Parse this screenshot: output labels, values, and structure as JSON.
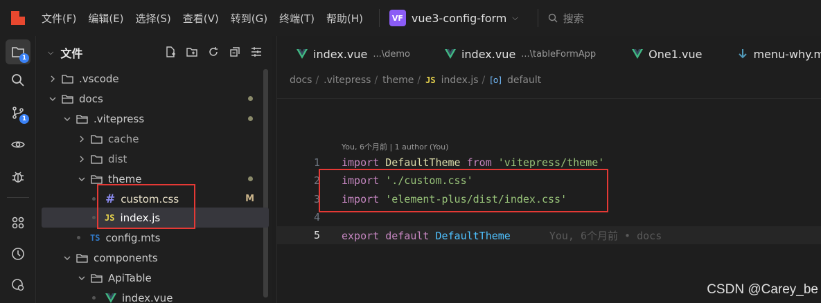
{
  "menu": [
    "文件(F)",
    "编辑(E)",
    "选择(S)",
    "查看(V)",
    "转到(G)",
    "终端(T)",
    "帮助(H)"
  ],
  "project": {
    "badge": "VF",
    "name": "vue3-config-form"
  },
  "search": {
    "placeholder": "搜索"
  },
  "activity_badges": {
    "explorer": "1",
    "scm": "1"
  },
  "sidebar": {
    "title": "文件",
    "tree": [
      {
        "label": ".vscode",
        "type": "folder",
        "expanded": false
      },
      {
        "label": "docs",
        "type": "folder",
        "expanded": true
      },
      {
        "label": ".vitepress",
        "type": "folder",
        "expanded": true
      },
      {
        "label": "cache",
        "type": "folder",
        "expanded": false
      },
      {
        "label": "dist",
        "type": "folder",
        "expanded": false
      },
      {
        "label": "theme",
        "type": "folder",
        "expanded": true
      },
      {
        "label": "custom.css",
        "type": "css",
        "status": "M"
      },
      {
        "label": "index.js",
        "type": "js",
        "selected": true
      },
      {
        "label": "config.mts",
        "type": "ts"
      },
      {
        "label": "components",
        "type": "folder",
        "expanded": true
      },
      {
        "label": "ApiTable",
        "type": "folder",
        "expanded": true
      },
      {
        "label": "index.vue",
        "type": "vue"
      }
    ]
  },
  "tabs": [
    {
      "name": "index.vue",
      "sub": "...\\demo",
      "icon": "vue-icon"
    },
    {
      "name": "index.vue",
      "sub": "...\\tableFormApp",
      "icon": "vue-icon"
    },
    {
      "name": "One1.vue",
      "sub": "",
      "icon": "vue-icon"
    },
    {
      "name": "menu-why.md",
      "sub": "",
      "icon": "markdown-icon"
    }
  ],
  "breadcrumb": [
    "docs",
    ".vitepress",
    "theme",
    "index.js",
    "default"
  ],
  "codelens": "You, 6个月前 | 1 author (You)",
  "code": {
    "line_numbers": [
      "1",
      "2",
      "3",
      "4",
      "5"
    ],
    "l1": {
      "kw": "import",
      "name": "DefaultTheme",
      "from": "from",
      "str": "'vitepress/theme'"
    },
    "l2": {
      "kw": "import",
      "str": "'./custom.css'"
    },
    "l3": {
      "kw": "import",
      "str": "'element-plus/dist/index.css'"
    },
    "l5": {
      "kw1": "export",
      "kw2": "default",
      "id": "DefaultTheme",
      "blame": "You, 6个月前 • docs"
    }
  },
  "watermark": "CSDN @Carey_be"
}
